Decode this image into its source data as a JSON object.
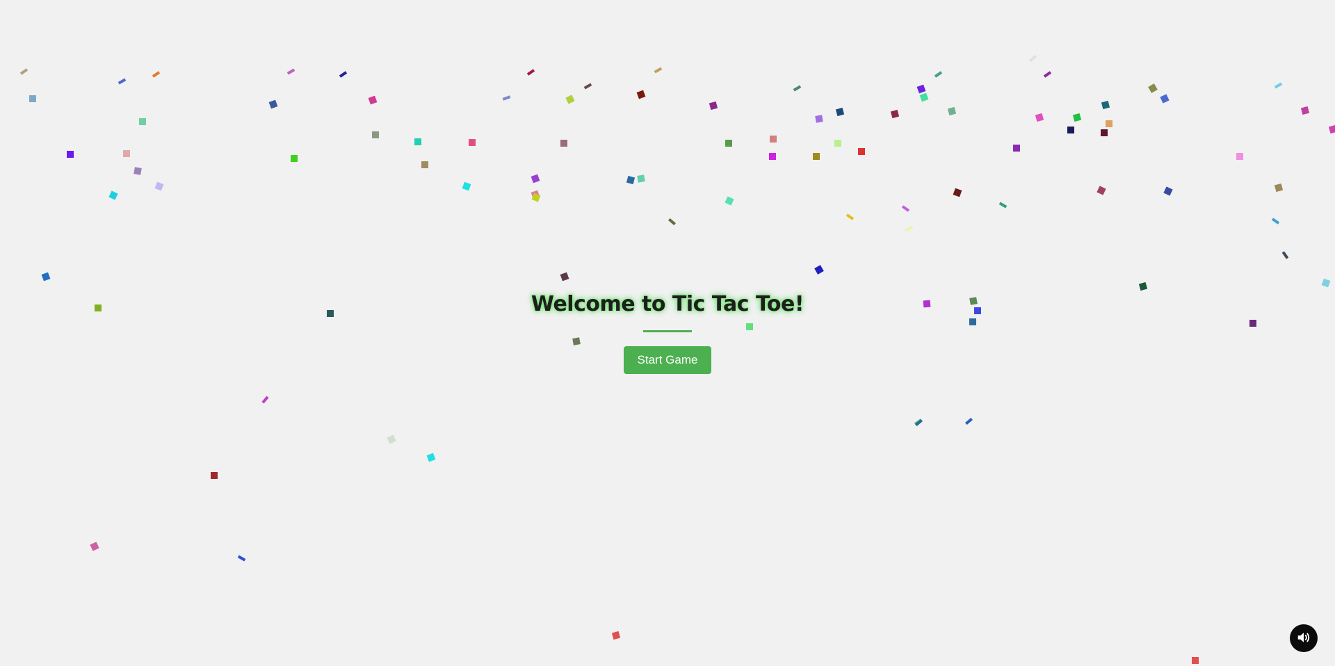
{
  "welcome": {
    "title": "Welcome to Tic Tac Toe!",
    "start_label": "Start Game"
  },
  "sound": {
    "icon": "speaker-volume-icon"
  },
  "colors": {
    "background": "#f1f1f1",
    "accent": "#4caf50",
    "title_glow": "#7be27a",
    "sound_button": "#0b0b0b"
  }
}
